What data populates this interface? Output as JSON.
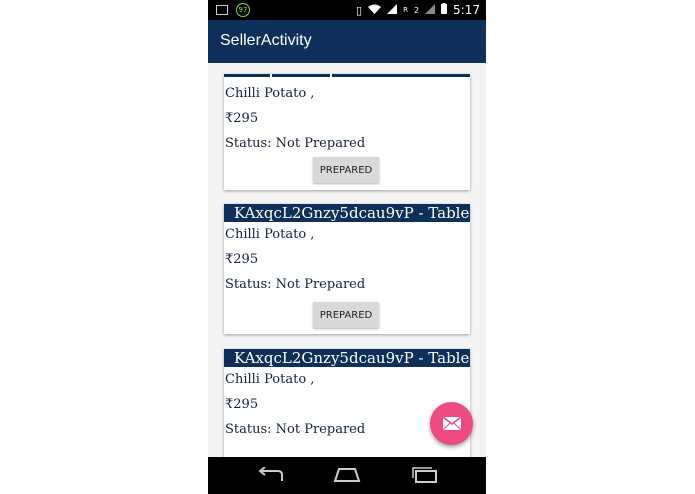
{
  "status_bar": {
    "badge": "97",
    "signal_label": "R",
    "sim": "2",
    "time": "5:17"
  },
  "app_bar": {
    "title": "SellerActivity"
  },
  "cards": [
    {
      "header": "",
      "item": "Chilli Potato ,",
      "price": "₹295",
      "status": "Status: Not Prepared",
      "button": "PREPARED"
    },
    {
      "header": "KAxqcL2Gnzy5dcau9vP - Table",
      "item": "Chilli Potato ,",
      "price": "₹295",
      "status": "Status: Not Prepared",
      "button": "PREPARED"
    },
    {
      "header": "KAxqcL2Gnzy5dcau9vP - Table",
      "item": "Chilli Potato ,",
      "price": "₹295",
      "status": "Status: Not Prepared",
      "button": ""
    }
  ],
  "fab": {
    "icon": "mail-icon",
    "color": "#ee4a81"
  },
  "colors": {
    "primary": "#0d2f5a",
    "accent": "#ee4a81"
  }
}
